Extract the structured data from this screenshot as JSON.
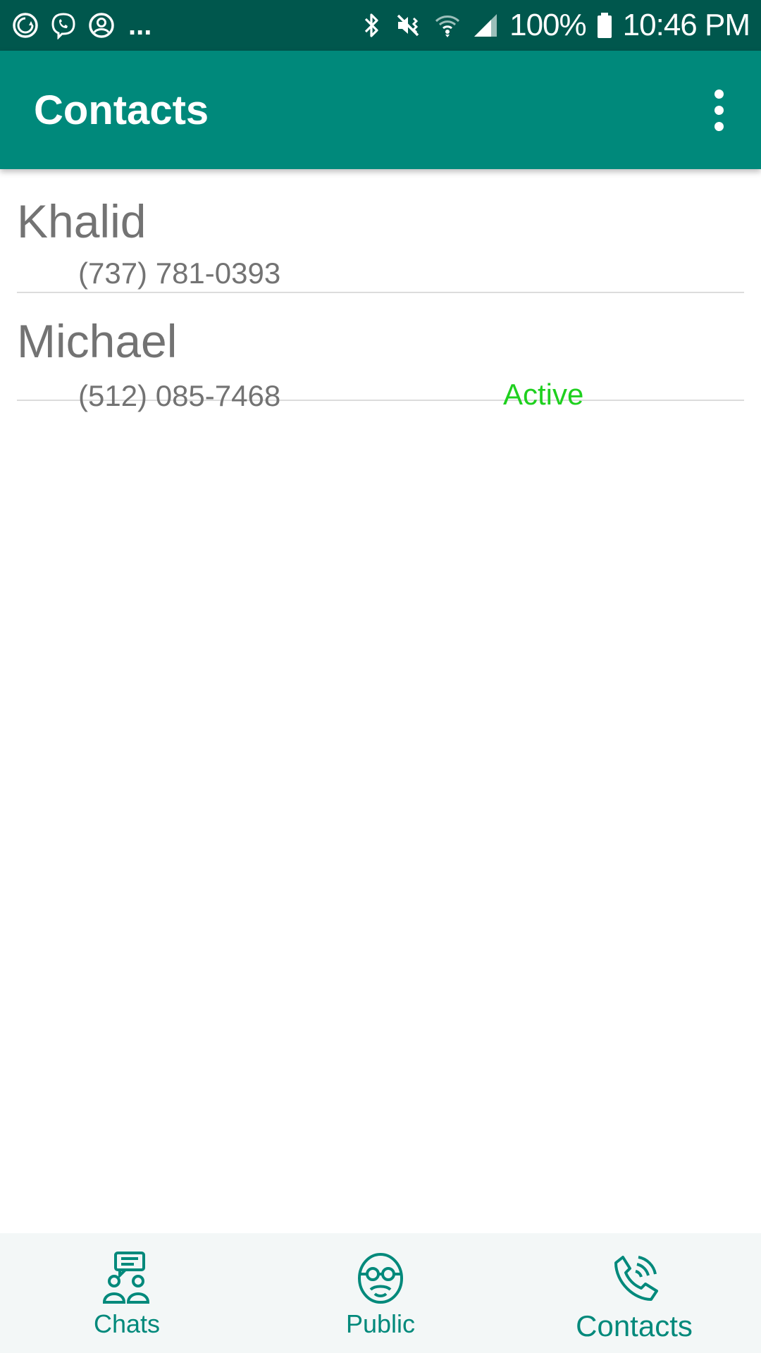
{
  "status_bar": {
    "battery": "100%",
    "time": "10:46 PM",
    "left_icons": [
      "sync-icon",
      "viber-icon",
      "account-icon"
    ],
    "overflow": "...",
    "right_icons": [
      "bluetooth-icon",
      "mute-vibrate-icon",
      "wifi-icon",
      "signal-icon",
      "battery-icon"
    ]
  },
  "app_bar": {
    "title": "Contacts",
    "menu_icon": "more-vert-icon"
  },
  "contacts": [
    {
      "name": "Khalid",
      "phone": "(737) 781-0393",
      "status": ""
    },
    {
      "name": "Michael",
      "phone": "(512) 085-7468",
      "status": "Active"
    }
  ],
  "bottom_nav": {
    "items": [
      {
        "label": "Chats",
        "icon": "chats-icon"
      },
      {
        "label": "Public",
        "icon": "public-face-icon"
      },
      {
        "label": "Contacts",
        "icon": "phone-call-icon"
      }
    ],
    "active": "Contacts"
  },
  "colors": {
    "status_bar": "#00574d",
    "app_bar": "#00897b",
    "accent": "#00897b",
    "active_status": "#1fd01f",
    "text_secondary": "#737373"
  }
}
